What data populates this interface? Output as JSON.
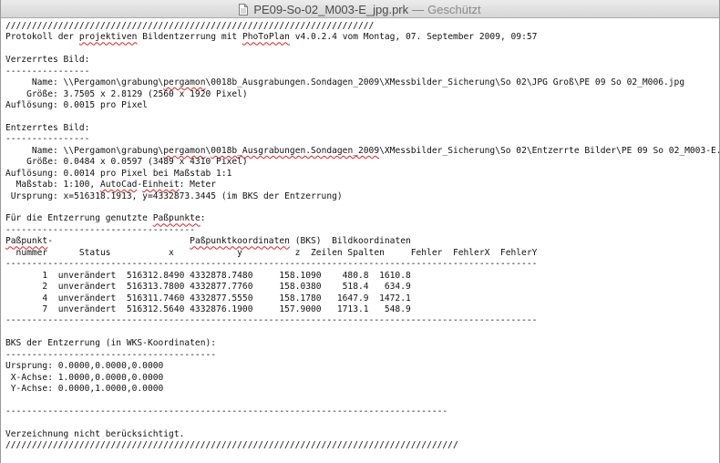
{
  "window": {
    "filename": "PE09-So-02_M003-E_jpg.prk",
    "separator": "—",
    "status": "Geschützt"
  },
  "colors": {
    "titlebar": "#dcdcdc",
    "spellcheck": "#e02020",
    "text": "#111111"
  },
  "icons": {
    "title_icon": "document-icon"
  },
  "document": {
    "lines": [
      {
        "text": "//////////////////////////////////////////////////////////////////////"
      },
      {
        "segments": [
          {
            "t": "Protokoll der "
          },
          {
            "t": "projektiven",
            "sq": true
          },
          {
            "t": " Bildentzerrung mit "
          },
          {
            "t": "PhoToPlan",
            "sq": true
          },
          {
            "t": " v4.0.2.4 vom Montag, 07. September 2009, 09:57"
          }
        ]
      },
      {
        "text": ""
      },
      {
        "text": "Verzerrtes Bild:"
      },
      {
        "text": "----------------"
      },
      {
        "segments": [
          {
            "t": "     Name: \\\\Pergamon\\grabung\\"
          },
          {
            "t": "pergamon",
            "sq": true
          },
          {
            "t": "\\0018b_Ausgrabungen.Sondagen_2009\\XMessbilder_Sicherung\\So 02\\JPG Groß\\PE 09 So 02_M006.jpg"
          }
        ]
      },
      {
        "text": "    Größe: 3.7505 x 2.8129 (2560 x 1920 Pixel)"
      },
      {
        "text": "Auflösung: 0.0015 pro Pixel"
      },
      {
        "text": ""
      },
      {
        "text": "Entzerrtes Bild:"
      },
      {
        "text": "----------------"
      },
      {
        "segments": [
          {
            "t": "     Name: \\\\Pergamon\\grabung\\"
          },
          {
            "t": "pergamon",
            "sq": true
          },
          {
            "t": "\\"
          },
          {
            "t": "0018b_Ausgrabungen.Sondagen_2009",
            "sq": true
          },
          {
            "t": "\\XMessbilder_Sicherung\\So 02\\Entzerrte Bilder\\PE 09 So 02_M003-E.jpg"
          }
        ]
      },
      {
        "text": "    Größe: 0.0484 x 0.0597 (3489 x 4310 Pixel)"
      },
      {
        "text": "Auflösung: 0.0014 pro Pixel bei Maßstab 1:1"
      },
      {
        "segments": [
          {
            "t": "  Maßstab: 1:100, "
          },
          {
            "t": "AutoCad",
            "sq": true
          },
          {
            "t": "-"
          },
          {
            "t": "Einheit",
            "sq": true
          },
          {
            "t": ": Meter"
          }
        ]
      },
      {
        "text": " Ursprung: x=516318.1913, y=4332873.3445 (im BKS der Entzerrung)"
      },
      {
        "text": ""
      },
      {
        "segments": [
          {
            "t": "Für die Entzerrung genutzte "
          },
          {
            "t": "Paßpunkte",
            "sq": true
          },
          {
            "t": ":"
          }
        ]
      },
      {
        "text": "------------------------------------"
      },
      {
        "segments": [
          {
            "t": "Paßpunkt",
            "sq": true
          },
          {
            "t": "-                          "
          },
          {
            "t": "Paßpunktkoordinaten",
            "sq": true
          },
          {
            "t": " (BKS)  Bildkoordinaten"
          }
        ]
      },
      {
        "text": "  nummer      Status           x            y          z  Zeilen Spalten     Fehler  FehlerX  FehlerY"
      },
      {
        "text": "-----------------------------------------------------------------------------------------------------"
      },
      {
        "text": "       1  unverändert  516312.8490 4332878.7480     158.1090    480.8  1610.8"
      },
      {
        "text": "       2  unverändert  516313.7800 4332877.7760     158.0380    518.4   634.9"
      },
      {
        "text": "       4  unverändert  516311.7460 4332877.5550     158.1780   1647.9  1472.1"
      },
      {
        "text": "       7  unverändert  516312.5640 4332876.1900     157.9000   1713.1   548.9"
      },
      {
        "text": "-----------------------------------------------------------------------------------------------------"
      },
      {
        "text": ""
      },
      {
        "text": "BKS der Entzerrung (in WKS-Koordinaten):"
      },
      {
        "text": "----------------------------------------"
      },
      {
        "text": "Ursprung: 0.0000,0.0000,0.0000"
      },
      {
        "text": " X-Achse: 1.0000,0.0000,0.0000"
      },
      {
        "text": " Y-Achse: 0.0000,1.0000,0.0000"
      },
      {
        "text": ""
      },
      {
        "text": "------------------------------------------------------------------------------------"
      },
      {
        "text": ""
      },
      {
        "text": "Verzeichnung nicht berücksichtigt."
      },
      {
        "text": "//////////////////////////////////////////////////////////////////////////////////////"
      }
    ]
  }
}
